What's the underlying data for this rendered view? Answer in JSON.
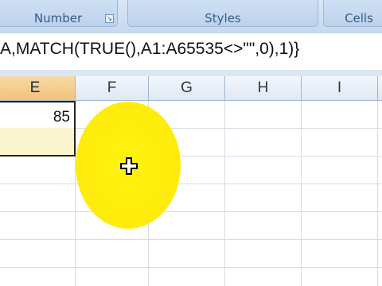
{
  "ribbon": {
    "groups": [
      {
        "label": "Number"
      },
      {
        "label": "Styles"
      },
      {
        "label": "Cells"
      }
    ]
  },
  "formula_bar": {
    "formula": "A,MATCH(TRUE(),A1:A65535<>\"\",0),1)}"
  },
  "columns": [
    {
      "label": "E",
      "active": true
    },
    {
      "label": "F"
    },
    {
      "label": "G"
    },
    {
      "label": "H"
    },
    {
      "label": "I"
    }
  ],
  "cells": {
    "E_value": "85"
  },
  "colors": {
    "highlight": "#ffec00",
    "active_header": "#f4c37d",
    "selection_fill": "#fbf6d0"
  },
  "icons": {
    "cursor": "plus-cursor-icon",
    "launcher": "dialog-launcher-icon"
  }
}
